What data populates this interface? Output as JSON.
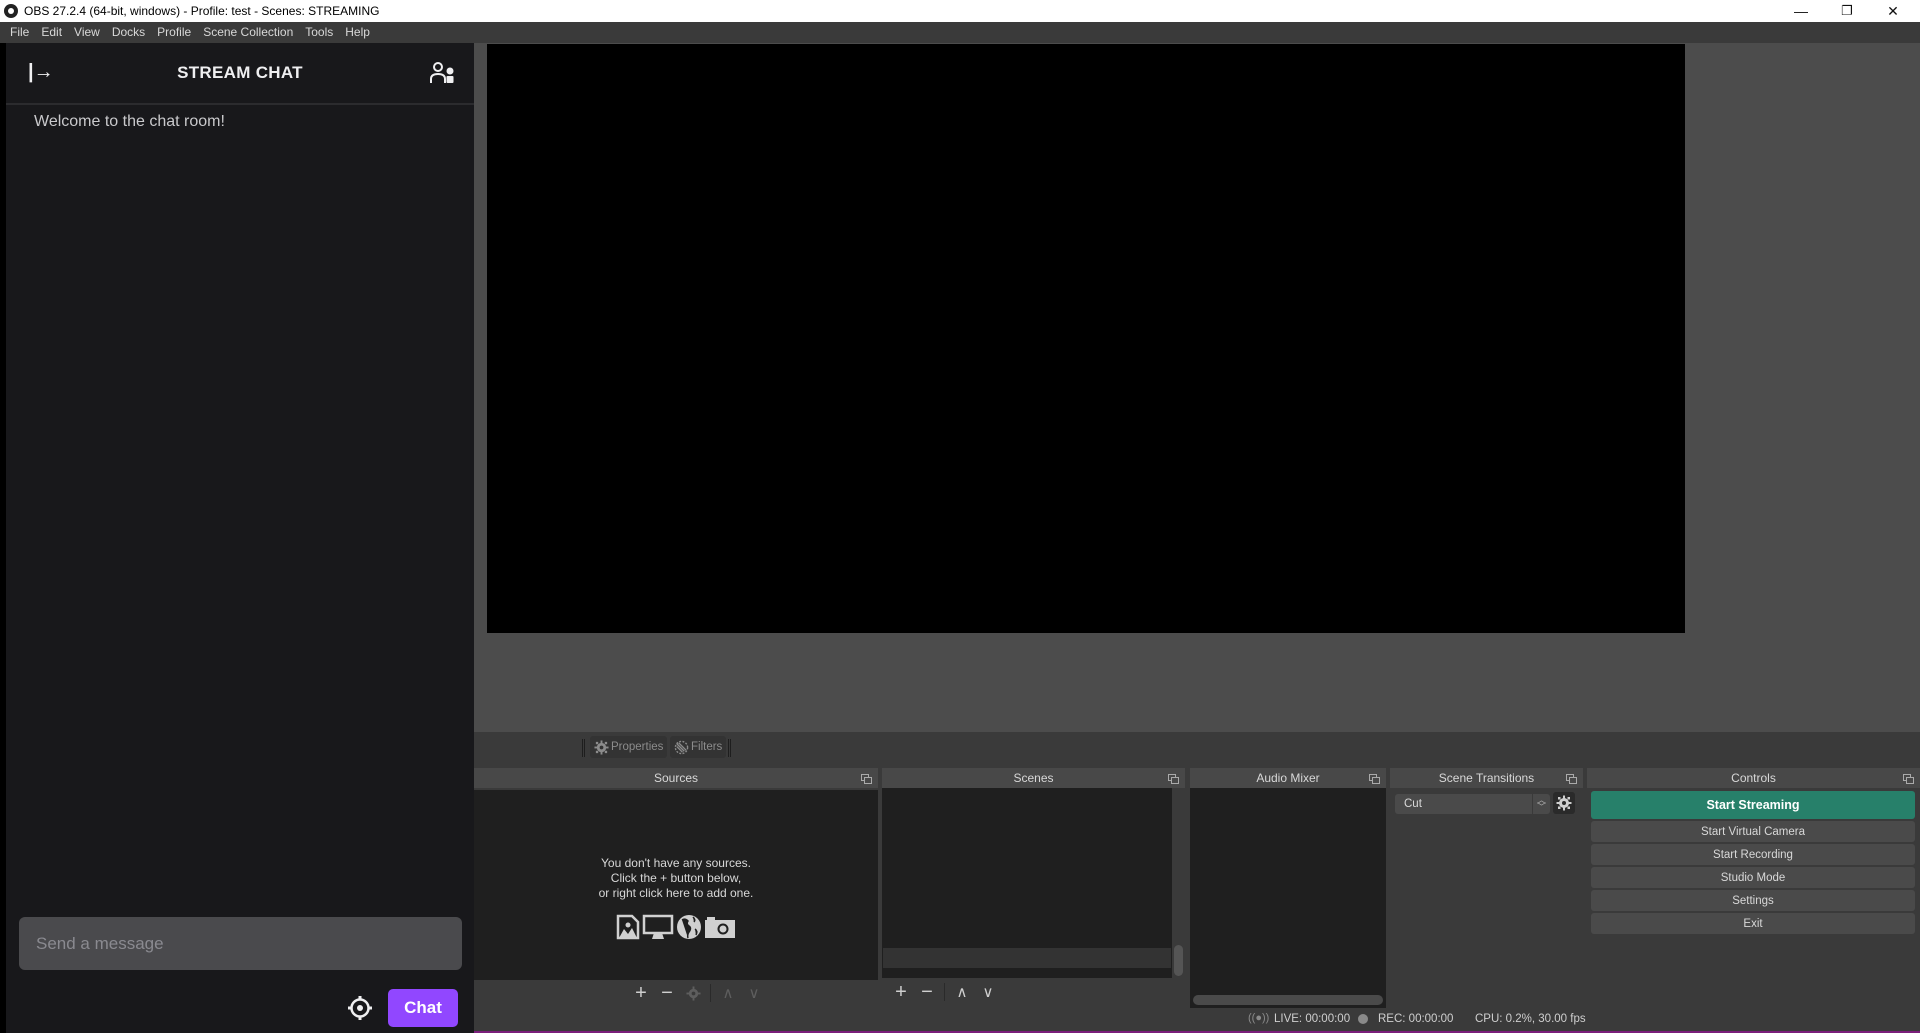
{
  "window": {
    "title": "OBS 27.2.4 (64-bit, windows) - Profile: test - Scenes: STREAMING",
    "controls": {
      "minimize": "—",
      "restore": "❐",
      "close": "✕"
    }
  },
  "menu": [
    "File",
    "Edit",
    "View",
    "Docks",
    "Profile",
    "Scene Collection",
    "Tools",
    "Help"
  ],
  "chat": {
    "title": "STREAM CHAT",
    "collapse_icon": "collapse-arrow-icon",
    "users_icon": "community-icon",
    "welcome": "Welcome to the chat room!",
    "input_placeholder": "Send a message",
    "send_label": "Chat",
    "accent": "#9147ff"
  },
  "preview_toolbar": {
    "properties_label": "Properties",
    "filters_label": "Filters"
  },
  "docks": {
    "sources": {
      "title": "Sources",
      "empty_line1": "You don't have any sources.",
      "empty_line2": "Click the + button below,",
      "empty_line3": "or right click here to add one.",
      "toolbar": {
        "add": "+",
        "remove": "−",
        "up": "∧",
        "down": "∨"
      }
    },
    "scenes": {
      "title": "Scenes",
      "toolbar": {
        "add": "+",
        "remove": "−",
        "up": "∧",
        "down": "∨"
      }
    },
    "audio_mixer": {
      "title": "Audio Mixer"
    },
    "scene_transitions": {
      "title": "Scene Transitions",
      "selected": "Cut"
    },
    "controls": {
      "title": "Controls",
      "buttons": [
        "Start Streaming",
        "Start Virtual Camera",
        "Start Recording",
        "Studio Mode",
        "Settings",
        "Exit"
      ],
      "accent": "#27806a"
    }
  },
  "status": {
    "live": "LIVE: 00:00:00",
    "rec": "REC: 00:00:00",
    "cpu": "CPU: 0.2%, 30.00 fps"
  }
}
